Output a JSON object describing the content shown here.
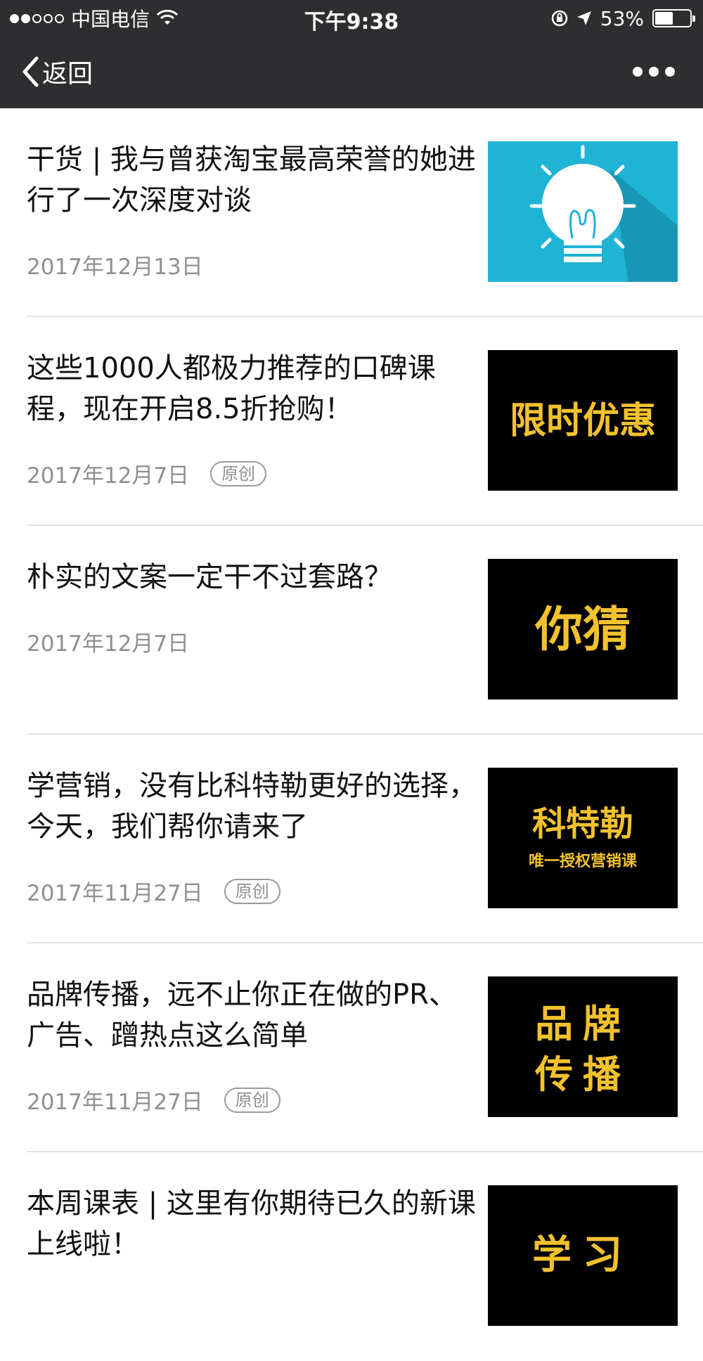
{
  "status_bar": {
    "carrier": "中国电信",
    "time": "下午9:38",
    "battery_percent": "53%",
    "battery_level": 0.53,
    "signal_bars_filled": 2,
    "signal_bars_total": 5
  },
  "nav": {
    "back_label": "返回",
    "more_icon": "more-icon"
  },
  "articles": [
    {
      "title": "干货 | 我与曾获淘宝最高荣誉的她进行了一次深度对谈",
      "date": "2017年12月13日",
      "tag": "",
      "thumb_icon": "lightbulb-icon",
      "thumb_bg": "#1fb3d6"
    },
    {
      "title": "这些1000人都极力推荐的口碑课程，现在开启8.5折抢购！",
      "date": "2017年12月7日",
      "tag": "原创",
      "thumb_text": "限时优惠",
      "thumb_bg": "#000000"
    },
    {
      "title": "朴实的文案一定干不过套路？",
      "date": "2017年12月7日",
      "tag": "",
      "thumb_text": "你猜",
      "thumb_bg": "#000000"
    },
    {
      "title": "学营销，没有比科特勒更好的选择，今天，我们帮你请来了",
      "date": "2017年11月27日",
      "tag": "原创",
      "thumb_text": "科特勒",
      "thumb_subtext": "唯一授权营销课",
      "thumb_bg": "#000000"
    },
    {
      "title": "品牌传播，远不止你正在做的PR、广告、蹭热点这么简单",
      "date": "2017年11月27日",
      "tag": "原创",
      "thumb_text": "品牌",
      "thumb_text2": "传播",
      "thumb_bg": "#000000"
    },
    {
      "title": "本周课表 | 这里有你期待已久的新课上线啦！",
      "date": "",
      "tag": "",
      "thumb_text": "学习",
      "thumb_bg": "#000000"
    }
  ],
  "colors": {
    "topbar": "#2e2e31",
    "gold_text": "#f2c12e",
    "date_gray": "#8f8f8f"
  }
}
